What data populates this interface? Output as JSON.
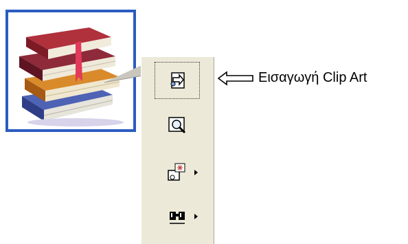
{
  "annotation": {
    "label": "Εισαγωγή Clip Art"
  },
  "clipart": {
    "icon": "books-clipart-icon",
    "frame_color": "#2b5cc0"
  },
  "toolbar": {
    "background": "#ece9d8",
    "buttons": [
      {
        "icon": "insert-clip-art-icon",
        "selected": true,
        "has_submenu": false
      },
      {
        "icon": "search-magnifier-icon",
        "selected": false,
        "has_submenu": false
      },
      {
        "icon": "clip-effects-icon",
        "selected": false,
        "has_submenu": true
      },
      {
        "icon": "binoculars-find-icon",
        "selected": false,
        "has_submenu": true
      }
    ]
  }
}
